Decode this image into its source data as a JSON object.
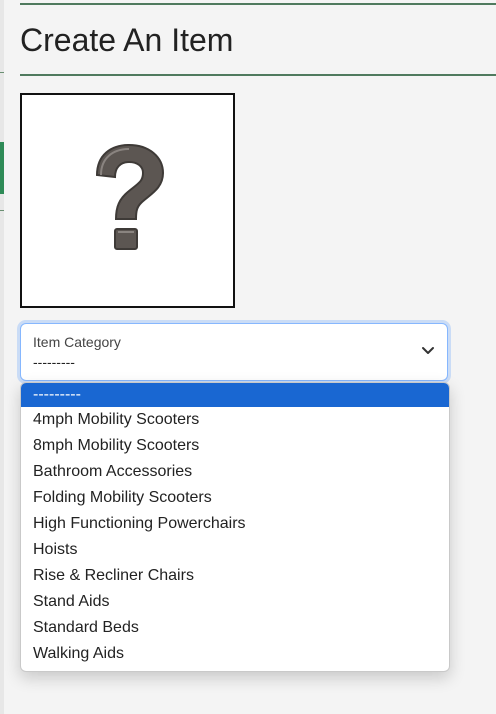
{
  "page": {
    "title": "Create An Item"
  },
  "image_placeholder": {
    "icon": "question-mark-icon"
  },
  "category_select": {
    "label": "Item Category",
    "value": "---------",
    "options": [
      "---------",
      "4mph Mobility Scooters",
      "8mph Mobility Scooters",
      "Bathroom Accessories",
      "Folding Mobility Scooters",
      "High Functioning Powerchairs",
      "Hoists",
      "Rise & Recliner Chairs",
      "Stand Aids",
      "Standard Beds",
      "Walking Aids"
    ],
    "selected_index": 0
  },
  "colors": {
    "accent_green": "#2e8b57",
    "rule_green": "#4f7a5e",
    "focus_blue": "#86b7fe",
    "option_selected": "#1967d2"
  }
}
